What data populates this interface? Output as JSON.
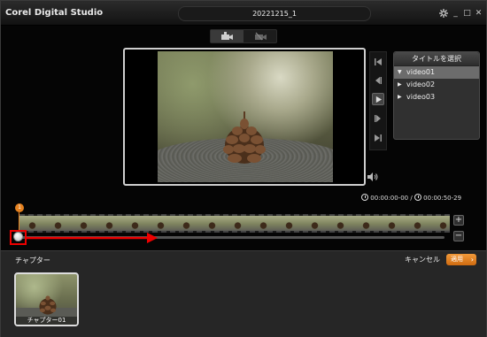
{
  "app": {
    "title": "Corel Digital Studio",
    "document_title": "20221215_1"
  },
  "window_controls": {
    "settings_icon": "gear-icon",
    "minimize": "_",
    "maximize": "□",
    "close": "✕"
  },
  "mode_tabs": [
    {
      "icon": "camera-chapter-icon",
      "active": true
    },
    {
      "icon": "camera-delete-icon",
      "active": false
    }
  ],
  "title_panel": {
    "header": "タイトルを選択",
    "items": [
      {
        "label": "video01",
        "selected": true,
        "arrow": "▼"
      },
      {
        "label": "video02",
        "selected": false,
        "arrow": "▶"
      },
      {
        "label": "video03",
        "selected": false,
        "arrow": "▶"
      }
    ]
  },
  "transport": [
    "skip-to-start-icon",
    "step-back-icon",
    "play-icon",
    "step-forward-icon",
    "skip-to-end-icon"
  ],
  "timecode": {
    "current": "00:00:00-00",
    "separator": "/",
    "total": "00:00:50-29"
  },
  "timeline": {
    "marker_label": "1",
    "zoom_in": "+",
    "zoom_out": "−",
    "position_fraction": 0
  },
  "chapter": {
    "label": "チャプター",
    "cancel": "キャンセル",
    "apply": "適用",
    "apply_chevron": "›",
    "items": [
      {
        "name": "チャプター01"
      }
    ]
  },
  "colors": {
    "accent": "#e5811f",
    "annotation_red": "#e00000"
  }
}
